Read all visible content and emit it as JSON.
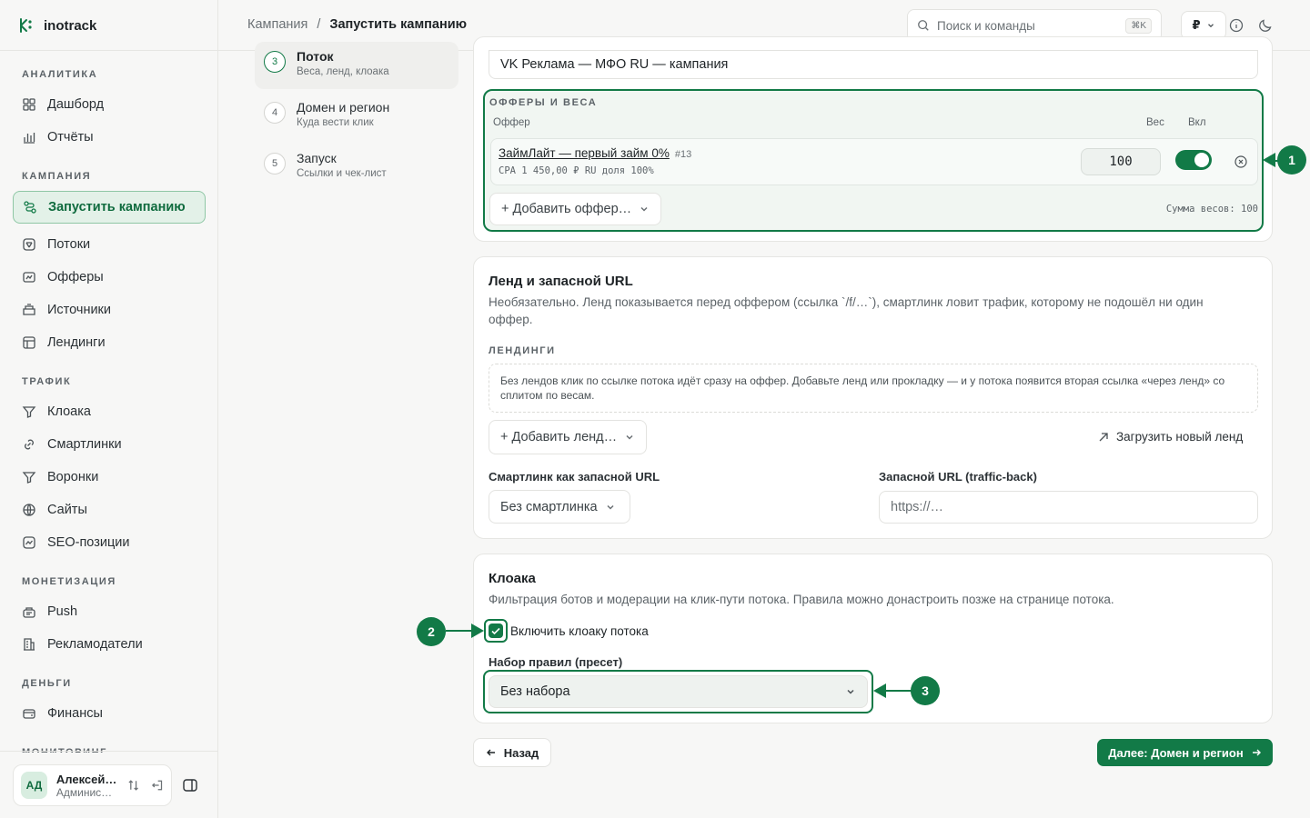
{
  "brand": {
    "name": "inotrack"
  },
  "sidebar": {
    "sections": [
      {
        "title": "АНАЛИТИКА",
        "items": [
          {
            "label": "Дашборд",
            "icon": "grid-icon"
          },
          {
            "label": "Отчёты",
            "icon": "bar-chart-icon"
          }
        ]
      },
      {
        "title": "КАМПАНИЯ",
        "items": [
          {
            "label": "Запустить кампанию",
            "icon": "route-icon",
            "active": true
          },
          {
            "label": "Потоки",
            "icon": "stream-icon"
          },
          {
            "label": "Офферы",
            "icon": "offer-icon"
          },
          {
            "label": "Источники",
            "icon": "source-icon"
          },
          {
            "label": "Лендинги",
            "icon": "landing-icon"
          }
        ]
      },
      {
        "title": "ТРАФИК",
        "items": [
          {
            "label": "Клоака",
            "icon": "filter-icon"
          },
          {
            "label": "Смартлинки",
            "icon": "link-icon"
          },
          {
            "label": "Воронки",
            "icon": "funnel-icon"
          },
          {
            "label": "Сайты",
            "icon": "globe-icon"
          },
          {
            "label": "SEO-позиции",
            "icon": "trend-icon"
          }
        ]
      },
      {
        "title": "МОНЕТИЗАЦИЯ",
        "items": [
          {
            "label": "Push",
            "icon": "push-icon"
          },
          {
            "label": "Рекламодатели",
            "icon": "building-icon"
          }
        ]
      },
      {
        "title": "ДЕНЬГИ",
        "items": [
          {
            "label": "Финансы",
            "icon": "wallet-icon"
          }
        ]
      },
      {
        "title": "МОНИТОРИНГ",
        "items": []
      }
    ],
    "user": {
      "initials": "АД",
      "name": "Алексей…",
      "role": "Админис…"
    }
  },
  "topbar": {
    "breadcrumb": [
      "Кампания",
      "/",
      "Запустить кампанию"
    ],
    "search_placeholder": "Поиск и команды",
    "search_kbd": "⌘K",
    "currency": "₽"
  },
  "steps": [
    {
      "num": "3",
      "title": "Поток",
      "sub": "Веса, ленд, клоака",
      "active": true
    },
    {
      "num": "4",
      "title": "Домен и регион",
      "sub": "Куда вести клик"
    },
    {
      "num": "5",
      "title": "Запуск",
      "sub": "Ссылки и чек-лист"
    }
  ],
  "flow": {
    "name_value": "VK Реклама — МФО RU — кампания",
    "offers": {
      "caption": "ОФФЕРЫ И ВЕСА",
      "col_offer": "Оффер",
      "col_weight": "Вес",
      "col_on": "Вкл",
      "rows": [
        {
          "name": "ЗаймЛайт — первый займ 0%",
          "id": "#13",
          "meta": "CPA 1 450,00 ₽ RU доля 100%",
          "weight": "100",
          "enabled": true
        }
      ],
      "add_button": "+ Добавить оффер…",
      "sum_label": "Сумма весов: 100"
    }
  },
  "landing": {
    "title": "Ленд и запасной URL",
    "desc": "Необязательно. Ленд показывается перед оффером (ссылка `/f/…`), смартлинк ловит трафик, которому не подошёл ни один оффер.",
    "caption": "ЛЕНДИНГИ",
    "empty_note": "Без лендов клик по ссылке потока идёт сразу на оффер. Добавьте ленд или прокладку — и у потока появится вторая ссылка «через ленд» со сплитом по весам.",
    "add_button": "+ Добавить ленд…",
    "upload_link": "Загрузить новый ленд",
    "smartlink_label": "Смартлинк как запасной URL",
    "smartlink_value": "Без смартлинка",
    "fallback_label": "Запасной URL (traffic-back)",
    "fallback_placeholder": "https://…"
  },
  "cloak": {
    "title": "Клоака",
    "desc": "Фильтрация ботов и модерации на клик-пути потока. Правила можно донастроить позже на странице потока.",
    "enable_label": "Включить клоаку потока",
    "enabled": true,
    "preset_label": "Набор правил (пресет)",
    "preset_value": "Без набора"
  },
  "footer": {
    "back": "Назад",
    "next": "Далее: Домен и регион"
  },
  "annotations": [
    "1",
    "2",
    "3"
  ],
  "colors": {
    "accent": "#127a47",
    "accent_soft": "#e3f1e8"
  }
}
